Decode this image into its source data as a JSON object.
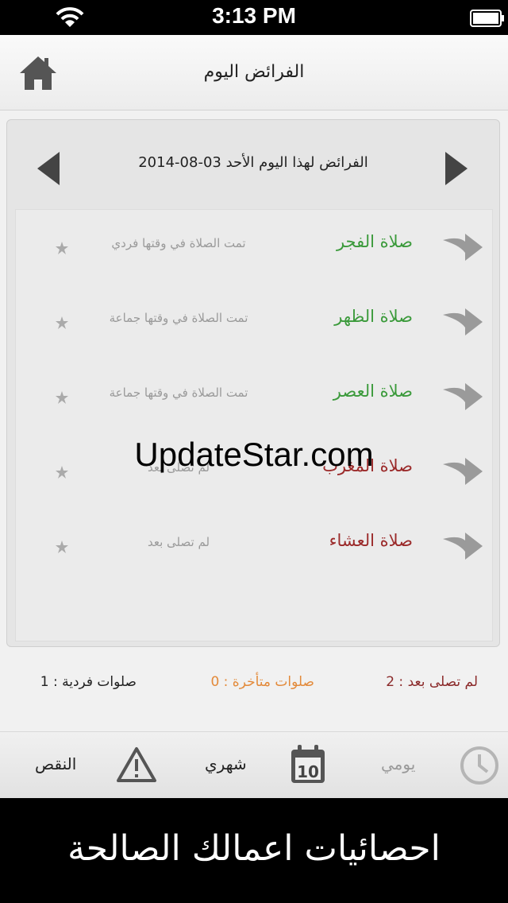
{
  "status_bar": {
    "time": "3:13 PM"
  },
  "header": {
    "title": "الفرائض اليوم"
  },
  "date_bar": {
    "text": "الفرائض لهذا اليوم الأحد 03-08-2014"
  },
  "prayers": [
    {
      "name": "صلاة الفجر",
      "status": "تمت الصلاة في وقتها فردي",
      "state": "done"
    },
    {
      "name": "صلاة الظهر",
      "status": "تمت الصلاة في وقتها جماعة",
      "state": "done"
    },
    {
      "name": "صلاة العصر",
      "status": "تمت الصلاة في وقتها جماعة",
      "state": "done"
    },
    {
      "name": "صلاة المغرب",
      "status": "لم تصلى بعد",
      "state": "pending"
    },
    {
      "name": "صلاة العشاء",
      "status": "لم تصلى بعد",
      "state": "pending"
    }
  ],
  "stats": {
    "not_prayed": "لم تصلى بعد : 2",
    "late": "صلوات متأخرة : 0",
    "individual": "صلوات فردية : 1"
  },
  "tabs": {
    "daily": "يومي",
    "monthly": "شهري",
    "deficit": "النقص",
    "calendar_day": "10"
  },
  "banner": {
    "text": "احصائيات اعمالك الصالحة"
  },
  "watermark": "UpdateStar.com",
  "colors": {
    "done": "#3b9a3b",
    "pending": "#9b2a2a",
    "late": "#e38a3a",
    "active_tab": "#9a9a9a"
  }
}
